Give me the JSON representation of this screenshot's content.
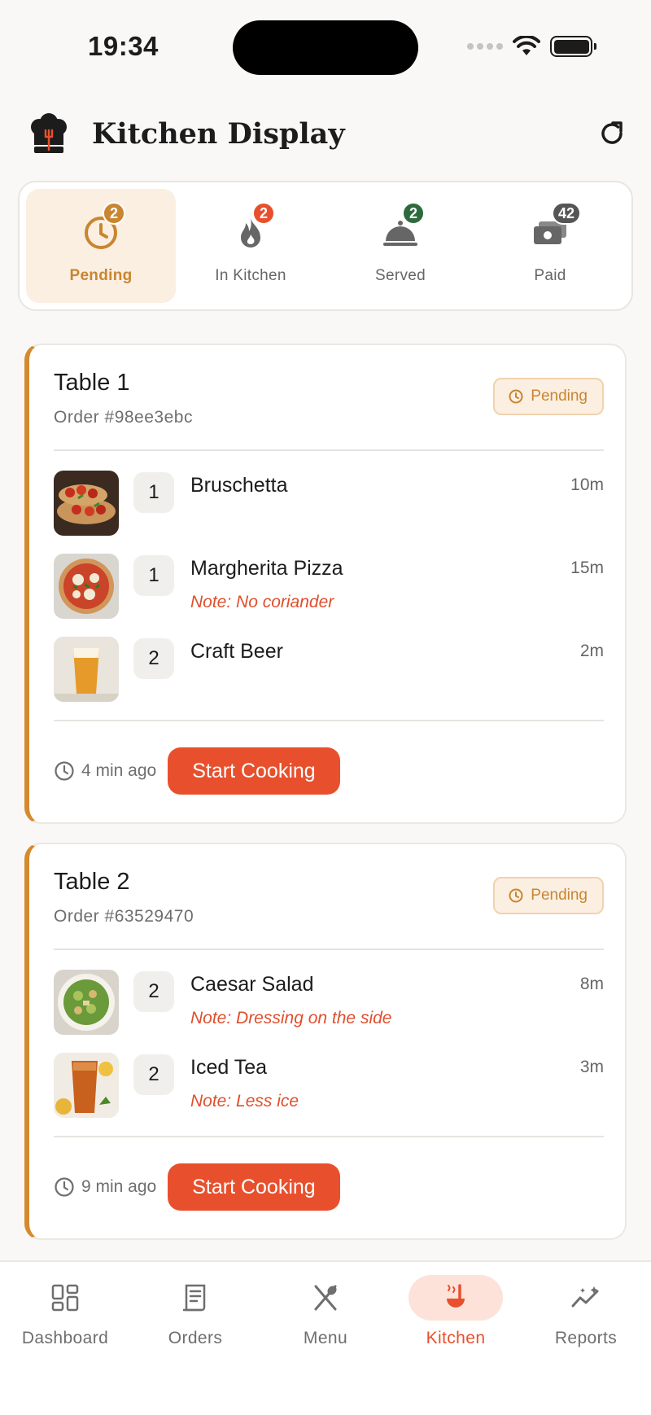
{
  "status_bar": {
    "time": "19:34"
  },
  "header": {
    "title": "Kitchen Display"
  },
  "tabs": [
    {
      "label": "Pending",
      "count": "2",
      "icon": "clock-icon",
      "badge_color": "#c98530",
      "active": true
    },
    {
      "label": "In Kitchen",
      "count": "2",
      "icon": "fire-icon",
      "badge_color": "#e8502d",
      "active": false
    },
    {
      "label": "Served",
      "count": "2",
      "icon": "cloche-icon",
      "badge_color": "#2e6b3c",
      "active": false
    },
    {
      "label": "Paid",
      "count": "42",
      "icon": "cash-icon",
      "badge_color": "#555555",
      "active": false
    }
  ],
  "orders": [
    {
      "table": "Table 1",
      "order_number": "Order #98ee3ebc",
      "status": "Pending",
      "items": [
        {
          "qty": "1",
          "name": "Bruschetta",
          "time": "10m",
          "note": ""
        },
        {
          "qty": "1",
          "name": "Margherita Pizza",
          "time": "15m",
          "note": "Note: No coriander"
        },
        {
          "qty": "2",
          "name": "Craft Beer",
          "time": "2m",
          "note": ""
        }
      ],
      "elapsed": "4 min ago",
      "action": "Start Cooking"
    },
    {
      "table": "Table 2",
      "order_number": "Order #63529470",
      "status": "Pending",
      "items": [
        {
          "qty": "2",
          "name": "Caesar Salad",
          "time": "8m",
          "note": "Note: Dressing on the side"
        },
        {
          "qty": "2",
          "name": "Iced Tea",
          "time": "3m",
          "note": "Note: Less ice"
        }
      ],
      "elapsed": "9 min ago",
      "action": "Start Cooking"
    }
  ],
  "bottom_nav": [
    {
      "label": "Dashboard",
      "icon": "dashboard-icon",
      "active": false
    },
    {
      "label": "Orders",
      "icon": "orders-icon",
      "active": false
    },
    {
      "label": "Menu",
      "icon": "utensils-icon",
      "active": false
    },
    {
      "label": "Kitchen",
      "icon": "ladle-icon",
      "active": true
    },
    {
      "label": "Reports",
      "icon": "reports-icon",
      "active": false
    }
  ],
  "colors": {
    "accent": "#e8502d",
    "pending": "#c98530",
    "served": "#2e6b3c",
    "note": "#e04e2c"
  }
}
